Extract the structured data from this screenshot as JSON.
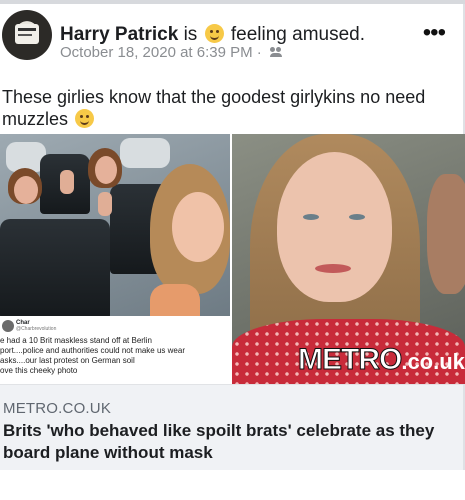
{
  "post": {
    "author": "Harry Patrick",
    "activity_prefix": "is",
    "activity_emoji": "slightly-smiling-emoji",
    "activity": "feeling amused.",
    "timestamp": "October 18, 2020 at 6:39 PM",
    "separator": "·",
    "audience_icon": "friends-icon",
    "more_icon": "•••",
    "text": "These girlies know that the goodest girlykins no need muzzles"
  },
  "embedded_tweet": {
    "name": "Char",
    "handle": "@Charbrevolution",
    "text": "e had a 10 Brit maskless stand off at Berlin\nport....police and authorities could not make us wear\nasks....our last protest on German soil\nove this cheeky photo"
  },
  "watermark": {
    "word": "METRO",
    "tld": ".co.uk"
  },
  "link_preview": {
    "domain": "METRO.CO.UK",
    "title": "Brits 'who behaved like spoilt brats' celebrate as they board plane without mask"
  },
  "colors": {
    "card": "#ffffff",
    "link_box": "#f0f2f5",
    "meta_text": "#8a8d91",
    "emoji": "#f7c947"
  }
}
